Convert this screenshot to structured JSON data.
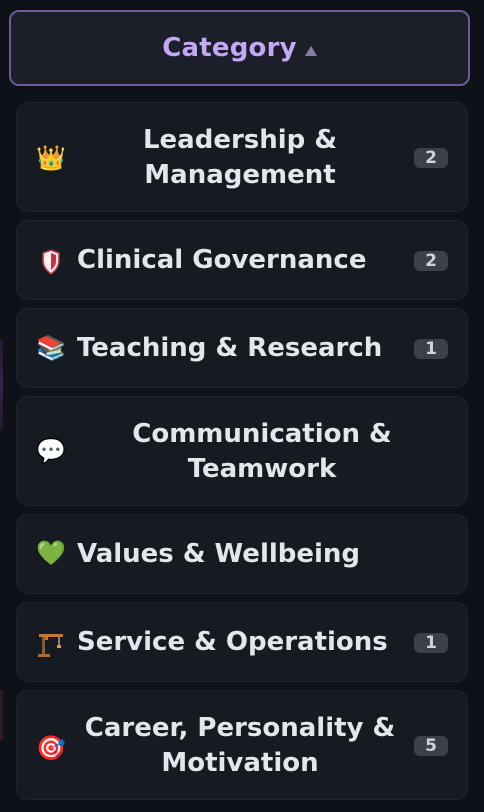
{
  "header": {
    "title": "Category"
  },
  "categories": [
    {
      "label": "Leadership & Management",
      "icon": "crown-icon",
      "glyph": "👑",
      "count": "2"
    },
    {
      "label": "Clinical Governance",
      "icon": "shield-icon",
      "glyph": "",
      "count": "2"
    },
    {
      "label": "Teaching & Research",
      "icon": "books-icon",
      "glyph": "📚",
      "count": "1"
    },
    {
      "label": "Communication & Teamwork",
      "icon": "speech-bubble-icon",
      "glyph": "💬",
      "count": ""
    },
    {
      "label": "Values & Wellbeing",
      "icon": "green-heart-icon",
      "glyph": "💚",
      "count": ""
    },
    {
      "label": "Service & Operations",
      "icon": "construction-crane-icon",
      "glyph": "",
      "count": "1"
    },
    {
      "label": "Career, Personality & Motivation",
      "icon": "target-icon",
      "glyph": "🎯",
      "count": "5"
    }
  ],
  "colors": {
    "accent": "#c3a8f5",
    "header_border": "#6e5a96",
    "card_bg": "#161b22",
    "badge_bg": "#3b4049"
  }
}
